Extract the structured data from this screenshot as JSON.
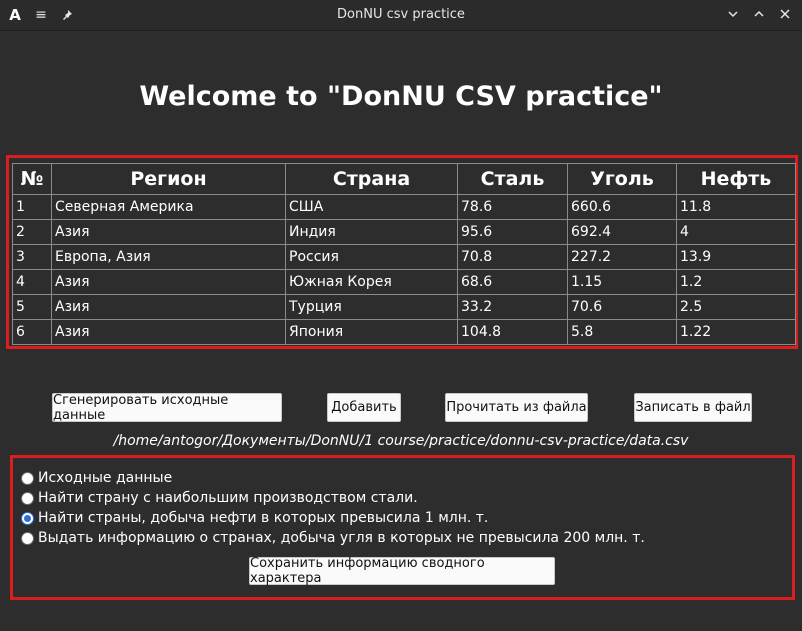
{
  "window": {
    "title": "DonNU csv practice",
    "app_icon_letter": "A",
    "menu_icon": "≡",
    "pin_icon": "📌",
    "minimize_icon": "⌄",
    "maximize_icon": "⌃",
    "close_icon": "✕"
  },
  "heading": "Welcome to \"DonNU CSV practice\"",
  "table": {
    "columns": [
      "№",
      "Регион",
      "Страна",
      "Сталь",
      "Уголь",
      "Нефть"
    ],
    "rows": [
      [
        "1",
        "Северная Америка",
        "США",
        "78.6",
        "660.6",
        "11.8"
      ],
      [
        "2",
        "Азия",
        "Индия",
        "95.6",
        "692.4",
        "4"
      ],
      [
        "3",
        "Европа, Азия",
        "Россия",
        "70.8",
        "227.2",
        "13.9"
      ],
      [
        "4",
        "Азия",
        "Южная Корея",
        "68.6",
        "1.15",
        "1.2"
      ],
      [
        "5",
        "Азия",
        "Турция",
        "33.2",
        "70.6",
        "2.5"
      ],
      [
        "6",
        "Азия",
        "Япония",
        "104.8",
        "5.8",
        "1.22"
      ]
    ]
  },
  "buttons": {
    "generate": "Сгенерировать исходные данные",
    "add": "Добавить",
    "read": "Прочитать из файла",
    "write": "Записать в файл"
  },
  "file_path": "/home/antogor/Документы/DonNU/1 course/practice/donnu-csv-practice/data.csv",
  "options": {
    "items": [
      {
        "label": "Исходные данные",
        "checked": false
      },
      {
        "label": "Найти страну с наибольшим производством стали.",
        "checked": false
      },
      {
        "label": "Найти страны, добыча нефти в которых превысила 1 млн. т.",
        "checked": true
      },
      {
        "label": "Выдать информацию о странах, добыча угля в которых не превысила 200 млн. т.",
        "checked": false
      }
    ],
    "save_label": "Сохранить информацию сводного характера"
  },
  "colors": {
    "highlight_frame": "#d81e1e",
    "window_bg": "#2d2d2d",
    "titlebar_bg": "#2b2b2b",
    "radio_accent": "#2a6fd6"
  }
}
